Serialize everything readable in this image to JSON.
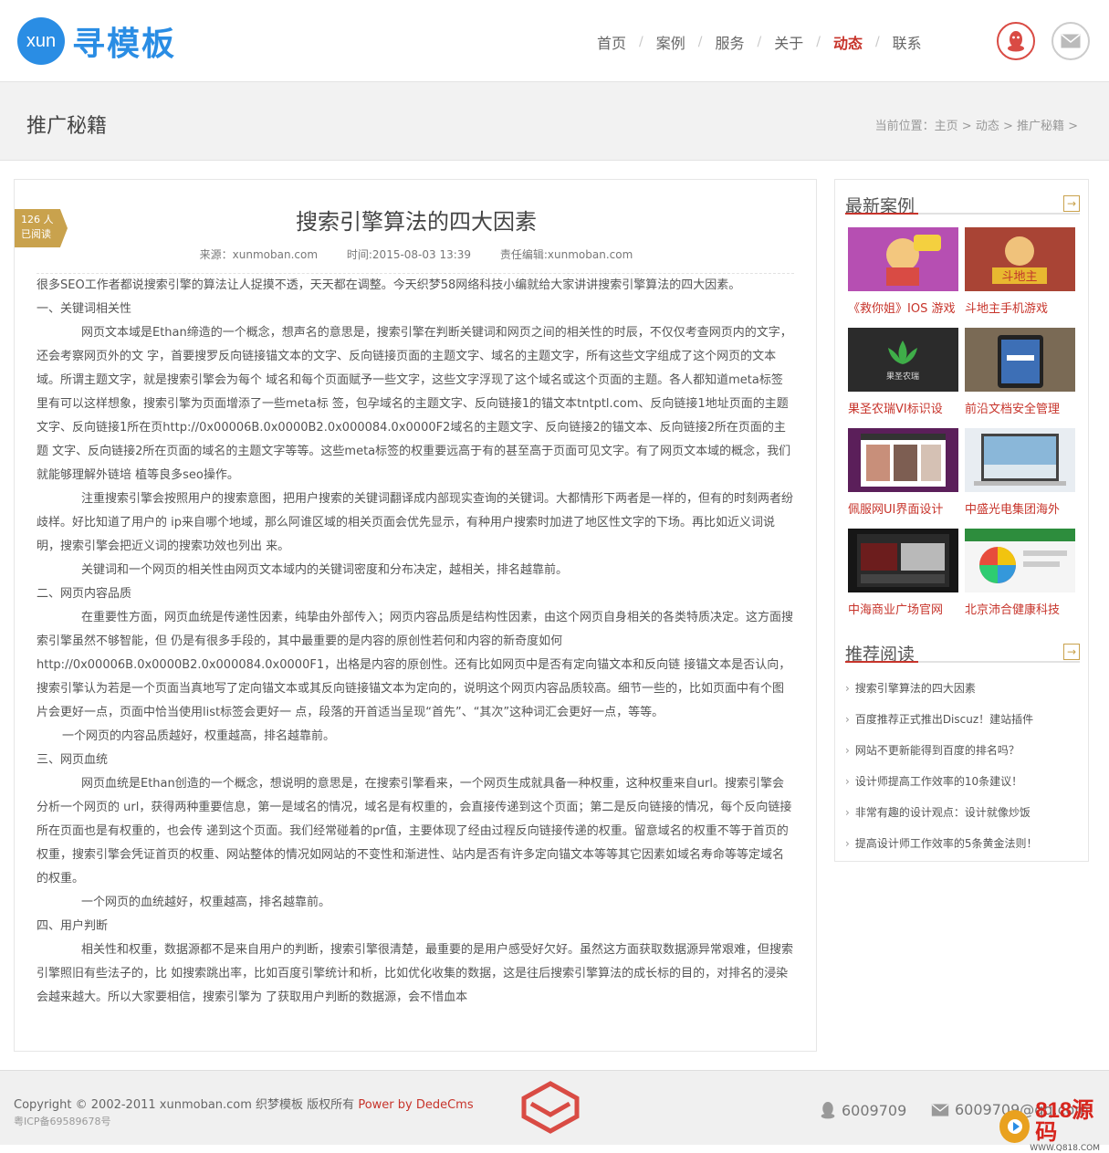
{
  "header": {
    "logo_badge": "xun",
    "logo_text": "寻模板",
    "nav": [
      {
        "label": "首页",
        "active": false
      },
      {
        "label": "案例",
        "active": false
      },
      {
        "label": "服务",
        "active": false
      },
      {
        "label": "关于",
        "active": false
      },
      {
        "label": "动态",
        "active": true
      },
      {
        "label": "联系",
        "active": false
      }
    ],
    "nav_separator": "/",
    "qq_icon": "qq-penguin-icon",
    "mail_icon": "envelope-icon"
  },
  "titlebar": {
    "title": "推广秘籍",
    "breadcrumb": "当前位置：主页 > 动态 > 推广秘籍 >"
  },
  "article": {
    "read_count": "126 人",
    "read_label": "已阅读",
    "title": "搜索引擎算法的四大因素",
    "source": "来源：xunmoban.com",
    "time": "时间:2015-08-03 13:39",
    "editor": "责任编辑:xunmoban.com",
    "paragraphs": [
      {
        "cls": "",
        "text": "很多SEO工作者都说搜索引擎的算法让人捉摸不透，天天都在调整。今天织梦58网络科技小编就给大家讲讲搜索引擎算法的四大因素。"
      },
      {
        "cls": "",
        "text": "一、关键词相关性"
      },
      {
        "cls": "ind",
        "text": "网页文本域是Ethan缔造的一个概念，想声名的意思是，搜索引擎在判断关键词和网页之间的相关性的时辰，不仅仅考查网页内的文字，还会考察网页外的文 字，首要搜罗反向链接锚文本的文字、反向链接页面的主题文字、域名的主题文字，所有这些文字组成了这个网页的文本域。所谓主题文字，就是搜索引擎会为每个 域名和每个页面赋予一些文字，这些文字浮现了这个域名或这个页面的主题。各人都知道meta标签里有可以这样想象，搜索引擎为页面增添了一些meta标 签，包孕域名的主题文字、反向链接1的锚文本tntptl.com、反向链接1地址页面的主题文字、反向链接1所在页http://0x00006B.0x0000B2.0x000084.0x0000F2域名的主题文字、反向链接2的锚文本、反向链接2所在页面的主题 文字、反向链接2所在页面的域名的主题文字等等。这些meta标签的权重要远高于有的甚至高于页面可见文字。有了网页文本域的概念，我们就能够理解外链培 植等良多seo操作。"
      },
      {
        "cls": "ind",
        "text": "注重搜索引擎会按照用户的搜索意图，把用户搜索的关键词翻译成内部现实查询的关键词。大都情形下两者是一样的，但有的时刻两者纷歧样。好比知道了用户的 ip来自哪个地域，那么阿谁区域的相关页面会优先显示，有种用户搜索时加进了地区性文字的下场。再比如近义词说明，搜索引擎会把近义词的搜索功效也列出 来。"
      },
      {
        "cls": "ind",
        "text": "关键词和一个网页的相关性由网页文本域内的关键词密度和分布决定，越相关，排名越靠前。"
      },
      {
        "cls": "",
        "text": "二、网页内容品质"
      },
      {
        "cls": "ind",
        "text": "在重要性方面，网页血统是传递性因素，纯挚由外部传入；网页内容品质是结构性因素，由这个网页自身相关的各类特质决定。这方面搜索引擎虽然不够智能，但 仍是有很多手段的，其中最重要的是内容的原创性若何和内容的新奇度如何http://0x00006B.0x0000B2.0x000084.0x0000F1，出格是内容的原创性。还有比如网页中是否有定向锚文本和反向链 接锚文本是否认向，搜索引擎认为若是一个页面当真地写了定向锚文本或其反向链接锚文本为定向的，说明这个网页内容品质较高。细节一些的，比如页面中有个图 片会更好一点，页面中恰当使用list标签会更好一 点，段落的开首适当呈现“首先”、“其次”这种词汇会更好一点，等等。"
      },
      {
        "cls": "ind2",
        "text": "一个网页的内容品质越好，权重越高，排名越靠前。"
      },
      {
        "cls": "",
        "text": "三、网页血统"
      },
      {
        "cls": "ind",
        "text": " 网页血统是Ethan创造的一个概念，想说明的意思是，在搜索引擎看来，一个网页生成就具备一种权重，这种权重来自url。搜索引擎会分析一个网页的 url，获得两种重要信息，第一是域名的情况，域名是有权重的，会直接传递到这个页面；第二是反向链接的情况，每个反向链接所在页面也是有权重的，也会传 递到这个页面。我们经常碰着的pr值，主要体现了经由过程反向链接传递的权重。留意域名的权重不等于首页的权重，搜索引擎会凭证首页的权重、网站整体的情况如网站的不变性和渐进性、站内是否有许多定向锚文本等等其它因素如域名寿命等等定域名的权重。"
      },
      {
        "cls": "ind",
        "text": " 一个网页的血统越好，权重越高，排名越靠前。"
      },
      {
        "cls": "",
        "text": "四、用户判断"
      },
      {
        "cls": "ind",
        "text": "相关性和权重，数据源都不是来自用户的判断，搜索引擎很清楚，最重要的是用户感受好欠好。虽然这方面获取数据源异常艰难，但搜索引擎照旧有些法子的，比 如搜索跳出率，比如百度引擎统计和析，比如优化收集的数据，这是往后搜索引擎算法的成长标的目的，对排名的浸染会越来越大。所以大家要相信，搜索引擎为 了获取用户判断的数据源，会不惜血本"
      }
    ]
  },
  "sidebar": {
    "cases_title": "最新案例",
    "more_symbol": "→",
    "cases": [
      {
        "caption": "《救你姐》IOS 游戏",
        "img": "cartoon-girl-thumb"
      },
      {
        "caption": "斗地主手机游戏",
        "img": "doudizhu-game-thumb"
      },
      {
        "caption": "果圣农瑞VI标识设",
        "img": "lotus-logo-thumb"
      },
      {
        "caption": "前沿文档安全管理",
        "img": "tablet-app-thumb"
      },
      {
        "caption": "佩服网UI界面设计",
        "img": "fashion-site-thumb"
      },
      {
        "caption": "中盛光电集团海外",
        "img": "laptop-site-thumb"
      },
      {
        "caption": "中海商业广场官网",
        "img": "dark-site-thumb"
      },
      {
        "caption": "北京沛合健康科技",
        "img": "colorwheel-site-thumb"
      }
    ],
    "reads_title": "推荐阅读",
    "reads": [
      "搜索引擎算法的四大因素",
      "百度推荐正式推出Discuz！建站插件",
      "网站不更新能得到百度的排名吗？",
      "设计师提高工作效率的10条建议！",
      "非常有趣的设计观点：设计就像炒饭",
      "提高设计师工作效率的5条黄金法则！"
    ],
    "chevron": "›"
  },
  "footer": {
    "copyright": "Copyright © 2002-2011 xunmoban.com 织梦模板 版权所有 ",
    "powered": "Power by DedeCms",
    "icp": "粤ICP备69589678号",
    "qq": "6009709",
    "email": "6009709@qq.com"
  },
  "watermark": {
    "text": "818源码",
    "sub": "WWW.Q818.COM"
  },
  "colors": {
    "accent": "#c7342b",
    "brand_blue": "#2a8de4",
    "gold": "#c9a24d"
  }
}
